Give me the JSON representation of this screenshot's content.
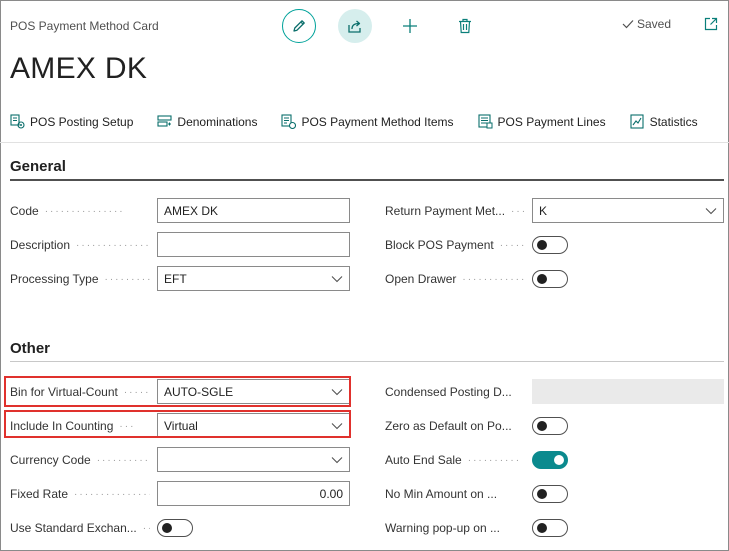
{
  "header": {
    "card_title": "POS Payment Method Card",
    "record_title": "AMEX DK",
    "saved_label": "Saved"
  },
  "actions": [
    {
      "label": "POS Posting Setup",
      "icon": "posting-setup-icon"
    },
    {
      "label": "Denominations",
      "icon": "denominations-icon"
    },
    {
      "label": "POS Payment Method Items",
      "icon": "payment-items-icon"
    },
    {
      "label": "POS Payment Lines",
      "icon": "payment-lines-icon"
    },
    {
      "label": "Statistics",
      "icon": "statistics-icon"
    }
  ],
  "general": {
    "heading": "General",
    "code": {
      "label": "Code",
      "value": "AMEX DK"
    },
    "description": {
      "label": "Description",
      "value": ""
    },
    "processing_type": {
      "label": "Processing Type",
      "value": "EFT"
    },
    "return_payment_method": {
      "label": "Return Payment Met...",
      "value": "K"
    },
    "block_pos_payment": {
      "label": "Block POS Payment",
      "value": false
    },
    "open_drawer": {
      "label": "Open Drawer",
      "value": false
    }
  },
  "other": {
    "heading": "Other",
    "bin_for_virtual_count": {
      "label": "Bin for Virtual-Count",
      "value": "AUTO-SGLE"
    },
    "include_in_counting": {
      "label": "Include In Counting",
      "value": "Virtual"
    },
    "currency_code": {
      "label": "Currency Code",
      "value": ""
    },
    "fixed_rate": {
      "label": "Fixed Rate",
      "value": "0.00"
    },
    "use_standard_exchange": {
      "label": "Use Standard Exchan...",
      "value": false
    },
    "condensed_posting": {
      "label": "Condensed Posting D...",
      "value": ""
    },
    "zero_as_default": {
      "label": "Zero as Default on Po...",
      "value": false
    },
    "auto_end_sale": {
      "label": "Auto End Sale",
      "value": true
    },
    "no_min_amount": {
      "label": "No Min Amount on ...",
      "value": false
    },
    "warning_popup": {
      "label": "Warning pop-up on ...",
      "value": false
    }
  },
  "colors": {
    "accent": "#00a29a",
    "toggle_on": "#0b8a8e",
    "highlight": "#e0312d"
  }
}
